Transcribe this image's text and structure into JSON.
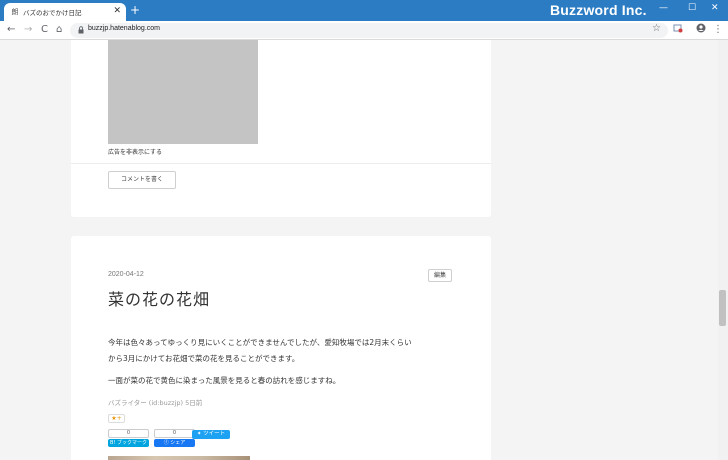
{
  "browser": {
    "tab_title": "バズのおでかけ日記",
    "tab_favicon": "朗",
    "new_tab": "+",
    "tab_close": "✕",
    "brand": "Buzzword Inc.",
    "url": "buzzjp.hatenablog.com",
    "window_controls": [
      "—",
      "☐",
      "✕"
    ]
  },
  "toolbar": {
    "back": "←",
    "forward": "→",
    "reload": "C",
    "home": "⌂",
    "star": "☆",
    "menu": "⋮"
  },
  "card1": {
    "ad_hide": "広告を非表示にする",
    "comment_button": "コメントを書く"
  },
  "post": {
    "date": "2020-04-12",
    "edit_button": "編集",
    "title": "菜の花の花畑",
    "paragraphs": [
      "今年は色々あってゆっくり見にいくことができませんでしたが、愛知牧場では2月末くらい",
      "から3月にかけてお花畑で菜の花を見ることができます。",
      "一面が菜の花で黄色に染まった風景を見ると春の訪れを感じますね。"
    ],
    "meta": "バズライター (id:buzzjp) 5日前",
    "star_button": "★+",
    "hatena_count": "0",
    "hatena_label": "B! ブックマーク",
    "fb_count": "0",
    "fb_label": "シェア",
    "tweet_label": "ツイート"
  },
  "colors": {
    "titlebar": "#2c7cc4",
    "hatena": "#00a4de",
    "facebook": "#1877f2",
    "twitter": "#1da1f2"
  }
}
